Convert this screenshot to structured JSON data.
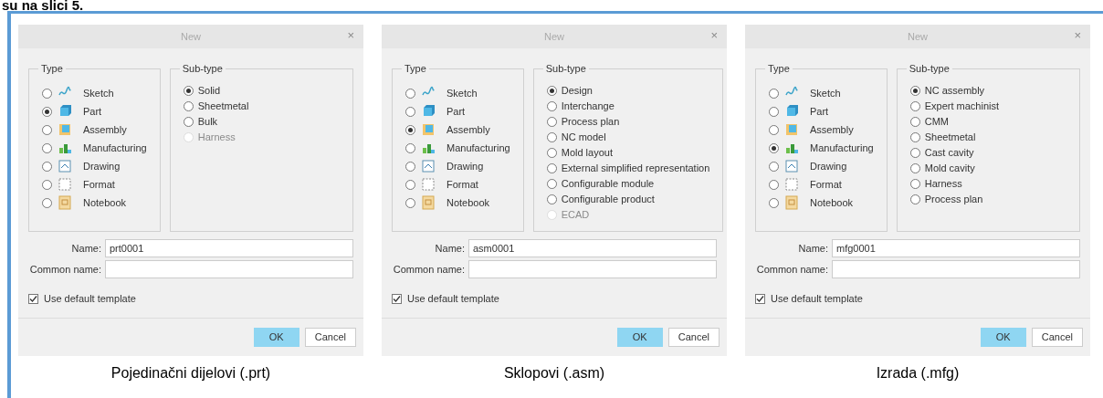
{
  "intro_text": "su na slici 5.",
  "figures": [
    {
      "dialog": {
        "title": "New",
        "close": "×",
        "type_group": {
          "label": "Type",
          "items": [
            {
              "label": "Sketch",
              "selected": false
            },
            {
              "label": "Part",
              "selected": true
            },
            {
              "label": "Assembly",
              "selected": false
            },
            {
              "label": "Manufacturing",
              "selected": false
            },
            {
              "label": "Drawing",
              "selected": false
            },
            {
              "label": "Format",
              "selected": false
            },
            {
              "label": "Notebook",
              "selected": false
            }
          ]
        },
        "subtype_group": {
          "label": "Sub-type",
          "items": [
            {
              "label": "Solid",
              "selected": true,
              "disabled": false
            },
            {
              "label": "Sheetmetal",
              "selected": false,
              "disabled": false
            },
            {
              "label": "Bulk",
              "selected": false,
              "disabled": false
            },
            {
              "label": "Harness",
              "selected": false,
              "disabled": true
            }
          ]
        },
        "name_field": {
          "label": "Name:",
          "value": "prt0001"
        },
        "common_name_field": {
          "label": "Common name:"
        },
        "template_checkbox": {
          "label": "Use default template",
          "checked": true
        },
        "buttons": [
          {
            "label": "OK",
            "kind": "primary"
          },
          {
            "label": "Cancel",
            "kind": "secondary"
          }
        ]
      },
      "caption": "Pojedinačni dijelovi (.prt)"
    },
    {
      "dialog": {
        "title": "New",
        "close": "×",
        "type_group": {
          "label": "Type",
          "items": [
            {
              "label": "Sketch",
              "selected": false
            },
            {
              "label": "Part",
              "selected": false
            },
            {
              "label": "Assembly",
              "selected": true
            },
            {
              "label": "Manufacturing",
              "selected": false
            },
            {
              "label": "Drawing",
              "selected": false
            },
            {
              "label": "Format",
              "selected": false
            },
            {
              "label": "Notebook",
              "selected": false
            }
          ]
        },
        "subtype_group": {
          "label": "Sub-type",
          "items": [
            {
              "label": "Design",
              "selected": true,
              "disabled": false
            },
            {
              "label": "Interchange",
              "selected": false,
              "disabled": false
            },
            {
              "label": "Process plan",
              "selected": false,
              "disabled": false
            },
            {
              "label": "NC model",
              "selected": false,
              "disabled": false
            },
            {
              "label": "Mold layout",
              "selected": false,
              "disabled": false
            },
            {
              "label": "External simplified representation",
              "selected": false,
              "disabled": false
            },
            {
              "label": "Configurable module",
              "selected": false,
              "disabled": false
            },
            {
              "label": "Configurable product",
              "selected": false,
              "disabled": false
            },
            {
              "label": "ECAD",
              "selected": false,
              "disabled": true
            }
          ]
        },
        "name_field": {
          "label": "Name:",
          "value": "asm0001"
        },
        "common_name_field": {
          "label": "Common name:"
        },
        "template_checkbox": {
          "label": "Use default template",
          "checked": true
        },
        "buttons": [
          {
            "label": "OK",
            "kind": "primary"
          },
          {
            "label": "Cancel",
            "kind": "secondary"
          }
        ]
      },
      "caption": "Sklopovi (.asm)"
    },
    {
      "dialog": {
        "title": "New",
        "close": "×",
        "type_group": {
          "label": "Type",
          "items": [
            {
              "label": "Sketch",
              "selected": false
            },
            {
              "label": "Part",
              "selected": false
            },
            {
              "label": "Assembly",
              "selected": false
            },
            {
              "label": "Manufacturing",
              "selected": true
            },
            {
              "label": "Drawing",
              "selected": false
            },
            {
              "label": "Format",
              "selected": false
            },
            {
              "label": "Notebook",
              "selected": false
            }
          ]
        },
        "subtype_group": {
          "label": "Sub-type",
          "items": [
            {
              "label": "NC assembly",
              "selected": true,
              "disabled": false
            },
            {
              "label": "Expert machinist",
              "selected": false,
              "disabled": false
            },
            {
              "label": "CMM",
              "selected": false,
              "disabled": false
            },
            {
              "label": "Sheetmetal",
              "selected": false,
              "disabled": false
            },
            {
              "label": "Cast cavity",
              "selected": false,
              "disabled": false
            },
            {
              "label": "Mold cavity",
              "selected": false,
              "disabled": false
            },
            {
              "label": "Harness",
              "selected": false,
              "disabled": false
            },
            {
              "label": "Process plan",
              "selected": false,
              "disabled": false
            }
          ]
        },
        "name_field": {
          "label": "Name:",
          "value": "mfg0001"
        },
        "common_name_field": {
          "label": "Common name:"
        },
        "template_checkbox": {
          "label": "Use default template",
          "checked": true
        },
        "buttons": [
          {
            "label": "OK",
            "kind": "primary"
          },
          {
            "label": "Cancel",
            "kind": "secondary"
          }
        ]
      },
      "caption": "Izrada (.mfg)"
    }
  ]
}
